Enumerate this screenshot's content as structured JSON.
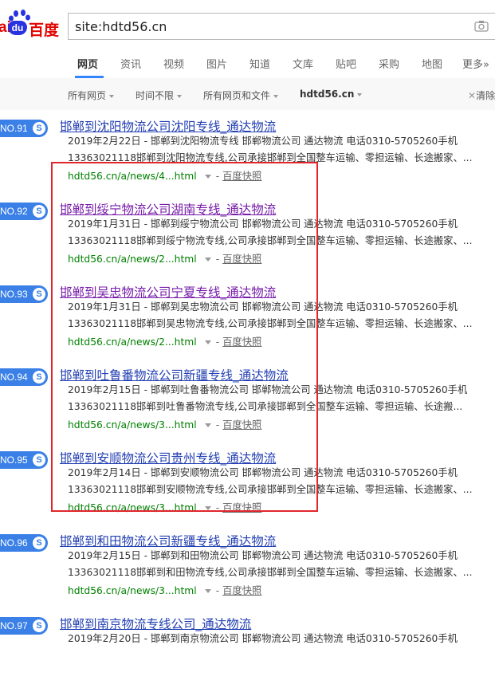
{
  "logo": {
    "part1": "ai",
    "part2": "du",
    "part3": "百度"
  },
  "search": {
    "value": "site:hdtd56.cn"
  },
  "tabs": [
    "网页",
    "资讯",
    "视频",
    "图片",
    "知道",
    "文库",
    "贴吧",
    "采购",
    "地图",
    "更多»"
  ],
  "active_tab": "网页",
  "filters": [
    "所有网页",
    "时间不限",
    "所有网页和文件",
    "hdtd56.cn"
  ],
  "clear_label": "清除",
  "snapshot_label": "百度快照",
  "url_separator": "-",
  "results": [
    {
      "no": "NO.91",
      "title": "邯郸到沈阳物流公司沈阳专线_通达物流",
      "visited": false,
      "line1": "2019年2月22日 - 邯郸到沈阳物流专线 邯郸物流公司 通达物流 电话0310-5705260手机",
      "line2": "13363021118邯郸到沈阳物流专线,公司承接邯郸到全国整车运输、零担运输、长途搬家、...",
      "url": "hdtd56.cn/a/news/4...html"
    },
    {
      "no": "NO.92",
      "title": "邯郸到绥宁物流公司湖南专线_通达物流",
      "visited": true,
      "line1": "2019年1月31日 - 邯郸到绥宁物流公司 邯郸物流公司 通达物流 电话0310-5705260手机",
      "line2": "13363021118邯郸到绥宁物流专线,公司承接邯郸到全国整车运输、零担运输、长途搬家、...",
      "url": "hdtd56.cn/a/news/2...html"
    },
    {
      "no": "NO.93",
      "title": "邯郸到吴忠物流公司宁夏专线_通达物流",
      "visited": true,
      "line1": "2019年1月31日 - 邯郸到吴忠物流公司 邯郸物流公司 通达物流 电话0310-5705260手机",
      "line2": "13363021118邯郸到吴忠物流专线,公司承接邯郸到全国整车运输、零担运输、长途搬家、...",
      "url": "hdtd56.cn/a/news/2...html"
    },
    {
      "no": "NO.94",
      "title": "邯郸到吐鲁番物流公司新疆专线_通达物流",
      "visited": false,
      "line1": "2019年2月15日 - 邯郸到吐鲁番物流公司 邯郸物流公司 通达物流 电话0310-5705260手机",
      "line2": "13363021118邯郸到吐鲁番物流专线,公司承接邯郸到全国整车运输、零担运输、长途搬...",
      "url": "hdtd56.cn/a/news/3...html"
    },
    {
      "no": "NO.95",
      "title": "邯郸到安顺物流公司贵州专线_通达物流",
      "visited": false,
      "line1": "2019年2月14日 - 邯郸到安顺物流公司 邯郸物流公司 通达物流 电话0310-5705260手机",
      "line2": "13363021118邯郸到安顺物流专线,公司承接邯郸到全国整车运输、零担运输、长途搬家、...",
      "url": "hdtd56.cn/a/news/3...html"
    },
    {
      "no": "NO.96",
      "title": "邯郸到和田物流公司新疆专线_通达物流",
      "visited": false,
      "line1": "2019年2月15日 - 邯郸到和田物流公司 邯郸物流公司 通达物流 电话0310-5705260手机",
      "line2": "13363021118邯郸到和田物流专线,公司承接邯郸到全国整车运输、零担运输、长途搬家、...",
      "url": "hdtd56.cn/a/news/3...html"
    },
    {
      "no": "NO.97",
      "title": "邯郸到南京物流专线公司_通达物流",
      "visited": false,
      "line1": "2019年2月20日 - 邯郸到南京物流公司 邯郸物流公司 通达物流 电话0310-5705260手机",
      "line2": "",
      "url": ""
    }
  ]
}
